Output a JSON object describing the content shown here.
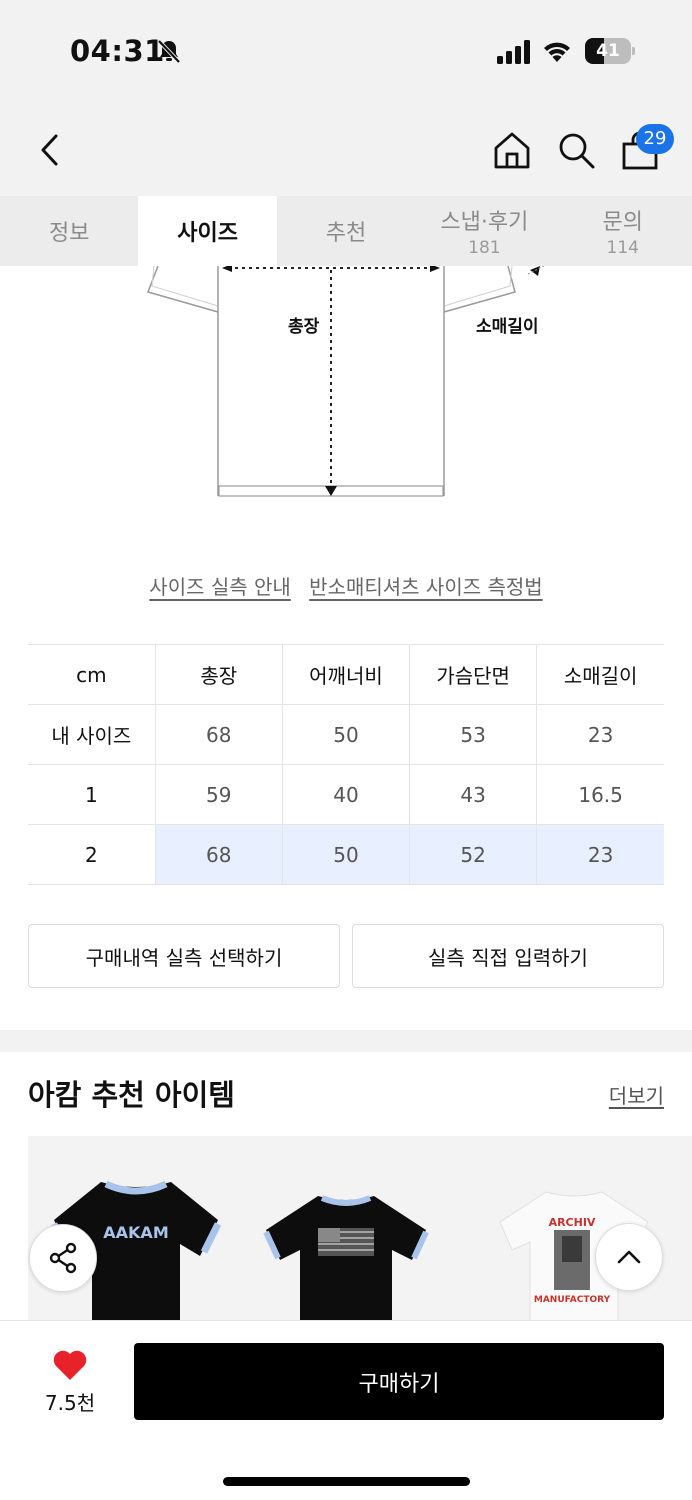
{
  "status": {
    "time": "04:31",
    "battery": "41",
    "battery_level": 0.41
  },
  "header": {
    "cart_count": "29"
  },
  "tabs": [
    {
      "label": "정보",
      "count": ""
    },
    {
      "label": "사이즈",
      "count": ""
    },
    {
      "label": "추천",
      "count": ""
    },
    {
      "label": "스냅·후기",
      "count": "181"
    },
    {
      "label": "문의",
      "count": "114"
    }
  ],
  "active_tab": "사이즈",
  "diagram": {
    "length_label": "총장",
    "sleeve_label": "소매길이"
  },
  "guide_links": [
    "사이즈 실측 안내",
    "반소매티셔츠 사이즈 측정법"
  ],
  "size_table": {
    "headers": [
      "cm",
      "총장",
      "어깨너비",
      "가슴단면",
      "소매길이"
    ],
    "rows": [
      {
        "label": "내 사이즈",
        "values": [
          "68",
          "50",
          "53",
          "23"
        ]
      },
      {
        "label": "1",
        "values": [
          "59",
          "40",
          "43",
          "16.5"
        ]
      },
      {
        "label": "2",
        "values": [
          "68",
          "50",
          "52",
          "23"
        ]
      }
    ]
  },
  "buttons": {
    "select_purchase": "구매내역 실측 선택하기",
    "direct_input": "실측 직접 입력하기"
  },
  "recommend": {
    "title": "아캄 추천 아이템",
    "more": "더보기",
    "product1_print": "AAKAM",
    "product3_print_top": "ARCHIV",
    "product3_print_bottom": "MANUFACTORY"
  },
  "bottom": {
    "like_count": "7.5천",
    "buy_label": "구매하기"
  },
  "colors": {
    "accent_blue": "#1a73e8",
    "highlight_row": "#e8efff",
    "like_red": "#e8222a"
  }
}
